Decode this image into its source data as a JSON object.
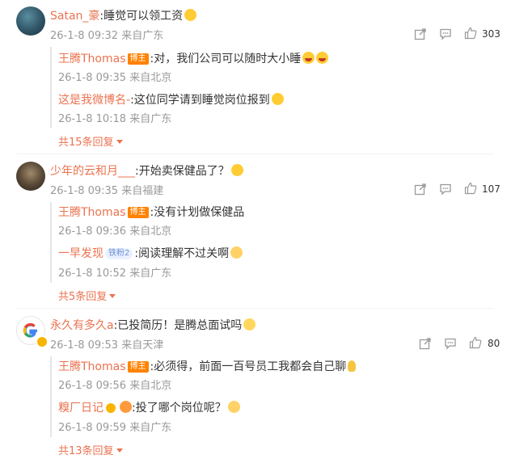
{
  "comments": [
    {
      "author": "Satan_豪",
      "text": ":睡觉可以领工资",
      "date": "26-1-8 09:32",
      "location": "来自广东",
      "likes": "303",
      "replies": [
        {
          "author": "王腾Thomas",
          "badge": "博主",
          "text": ":对，我们公司可以随时大小睡",
          "date": "26-1-8 09:35",
          "location": "来自北京"
        },
        {
          "author": "这是我微博名-",
          "text": ":这位同学请到睡觉岗位报到",
          "date": "26-1-8 10:18",
          "location": "来自广东"
        }
      ],
      "more": "共15条回复"
    },
    {
      "author": "少年的云和月___",
      "text": ":开始卖保健品了？",
      "date": "26-1-8 09:35",
      "location": "来自福建",
      "likes": "107",
      "replies": [
        {
          "author": "王腾Thomas",
          "badge": "博主",
          "text": ":没有计划做保健品",
          "date": "26-1-8 09:36",
          "location": "来自北京"
        },
        {
          "author": "一早发现",
          "badge": "铁粉2",
          "text": ":阅读理解不过关啊",
          "date": "26-1-8 10:52",
          "location": "来自广东"
        }
      ],
      "more": "共5条回复"
    },
    {
      "author": "永久有多久a",
      "text": ":已投简历！是腾总面试吗",
      "date": "26-1-8 09:53",
      "location": "来自天津",
      "likes": "80",
      "replies": [
        {
          "author": "王腾Thomas",
          "badge": "博主",
          "text": ":必须得，前面一百号员工我都会自己聊",
          "date": "26-1-8 09:56",
          "location": "来自北京"
        },
        {
          "author": "糗厂日记",
          "text": ":投了哪个岗位呢？",
          "date": "26-1-8 09:59",
          "location": "来自广东"
        }
      ],
      "more": "共13条回复"
    }
  ]
}
